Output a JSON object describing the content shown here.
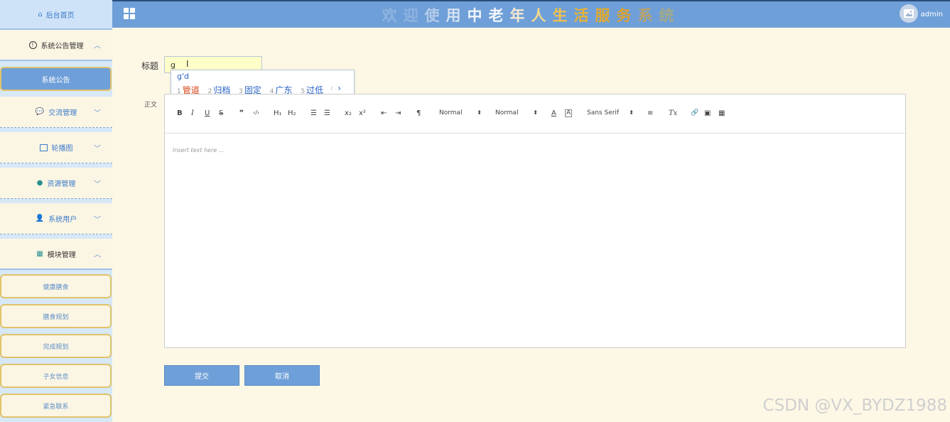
{
  "sidebar": {
    "home": "后台首页",
    "announcement_section": "系统公告管理",
    "announcement_active": "系统公告",
    "exchange": "交流管理",
    "carousel": "轮播图",
    "resources": "资源管理",
    "users": "系统用户",
    "modules": "模块管理",
    "module_items": [
      "健康膳食",
      "膳食规划",
      "完成规划",
      "子女信息",
      "紧急联系"
    ]
  },
  "header": {
    "title_chars": [
      "欢",
      "迎",
      "使",
      "用",
      "中",
      "老",
      "年",
      "人",
      "生",
      "活",
      "服",
      "务",
      "系",
      "统"
    ],
    "title_colors": [
      "#8fb4e0",
      "#8fb4e0",
      "#b5cbe8",
      "#d6e2f2",
      "#f3f6fb",
      "#f3f6fb",
      "#f6ead0",
      "#f5d98a",
      "#f0c04a",
      "#e9b233",
      "#e3a92b",
      "#d9a230",
      "#b9a36a",
      "#a3a98a"
    ],
    "user": "admin"
  },
  "form": {
    "title_label": "标题",
    "title_value": "g",
    "body_label": "正文",
    "body_placeholder": "Insert text here ...",
    "submit": "提交",
    "cancel": "取消"
  },
  "ime": {
    "composition": "g'd",
    "candidates": [
      {
        "num": "1",
        "text": "管道"
      },
      {
        "num": "2",
        "text": "归档"
      },
      {
        "num": "3",
        "text": "固定"
      },
      {
        "num": "4",
        "text": "广东"
      },
      {
        "num": "5",
        "text": "过低"
      }
    ],
    "prev": "‹",
    "next": "›"
  },
  "toolbar": {
    "bold": "B",
    "italic": "I",
    "underline": "U",
    "strike": "S",
    "quote": "❞",
    "code": "‹/›",
    "h1": "H₁",
    "h2": "H₂",
    "ol": "☰",
    "ul": "☰",
    "sub": "x₂",
    "sup": "x²",
    "outdent": "⇤",
    "indent": "⇥",
    "direction": "¶",
    "size": "Normal",
    "header": "Normal",
    "color": "A",
    "background": "A",
    "font": "Sans Serif",
    "align": "≡",
    "clean": "Tx",
    "link": "🔗",
    "image": "▣",
    "video": "▦"
  },
  "watermark": "CSDN @VX_BYDZ1988"
}
